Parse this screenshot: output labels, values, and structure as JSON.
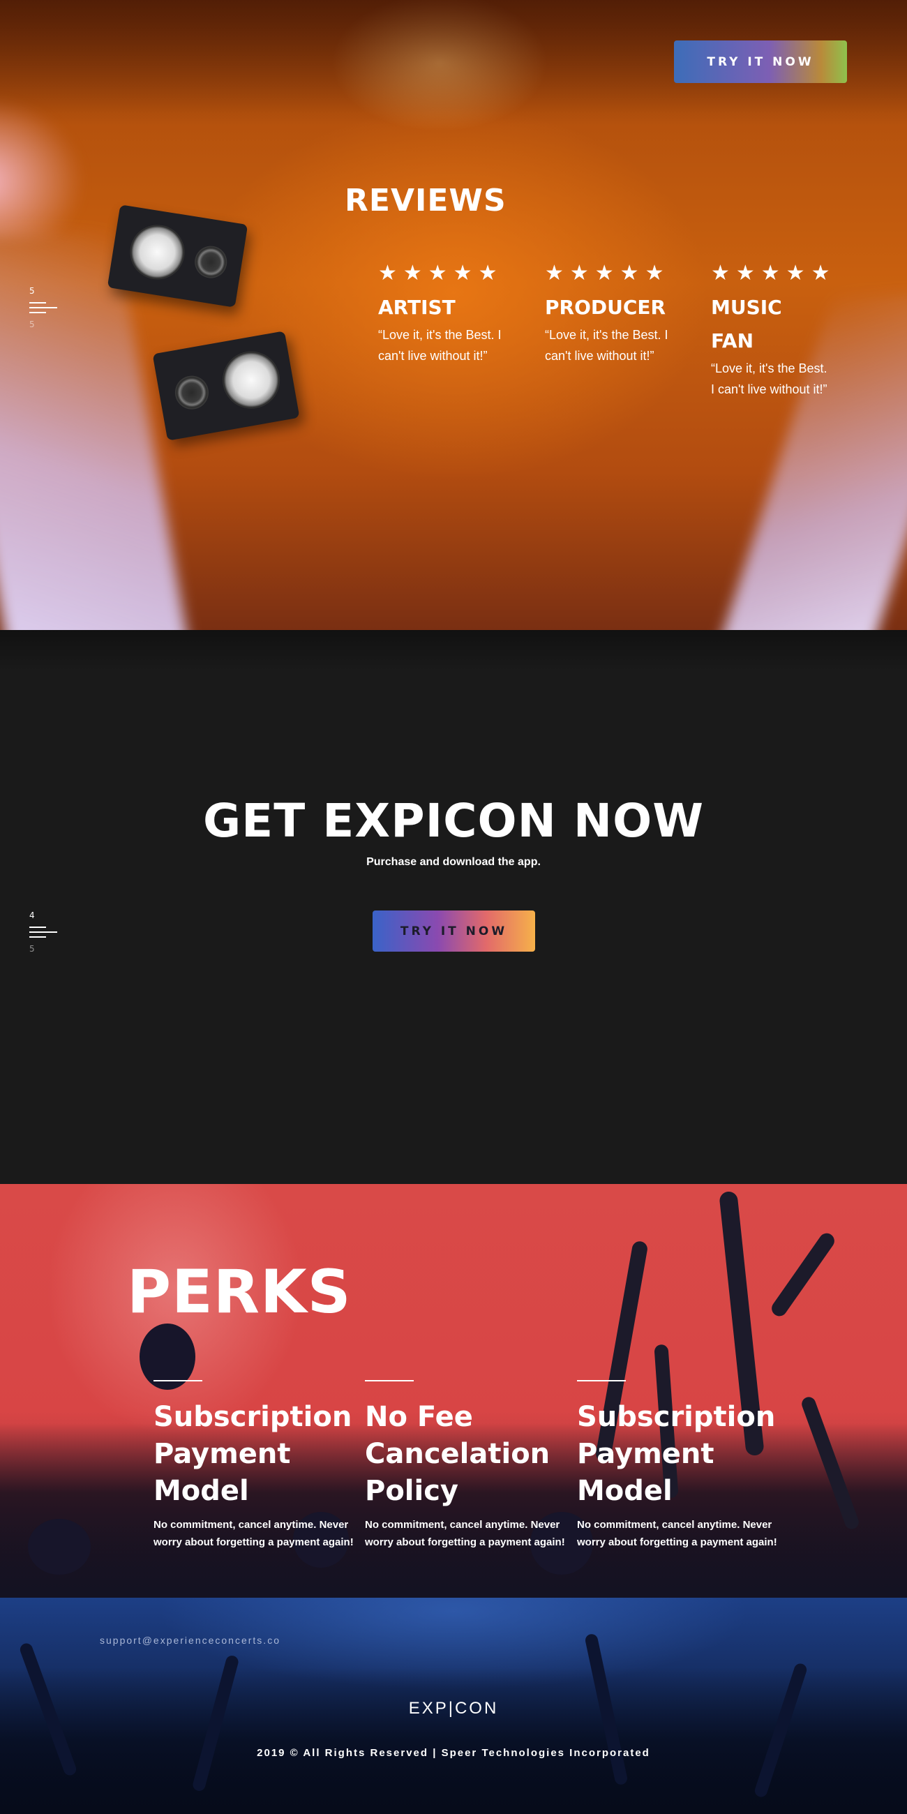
{
  "reviews": {
    "cta_label": "TRY IT NOW",
    "title": "REVIEWS",
    "nav": {
      "current": "5",
      "next": "5"
    },
    "items": [
      {
        "stars": "★★★★★",
        "role": "ARTIST",
        "quote": "“Love it, it's the Best. I can't live without it!”"
      },
      {
        "stars": "★★★★★",
        "role": "PRODUCER",
        "quote": "“Love it, it's the Best. I can't live without it!”"
      },
      {
        "stars": "★★★★★",
        "role": "MUSIC FAN",
        "quote": "“Love it, it's the Best. I can't live without it!”"
      }
    ]
  },
  "get_app": {
    "title": "GET EXPICON NOW",
    "subtitle": "Purchase and download the app.",
    "cta_label": "TRY IT NOW",
    "nav": {
      "current": "4",
      "next": "5"
    }
  },
  "perks": {
    "title": "PERKS",
    "items": [
      {
        "title": "Subscription Payment Model",
        "description": "No commitment, cancel anytime. Never worry about forgetting a payment again!"
      },
      {
        "title": "No Fee Cancelation Policy",
        "description": "No commitment, cancel anytime. Never worry about forgetting a payment again!"
      },
      {
        "title": "Subscription Payment Model",
        "description": "No commitment, cancel anytime. Never worry about forgetting a payment again!"
      }
    ]
  },
  "footer": {
    "support_email": "support@experienceconcerts.co",
    "logo": "EXP|CON",
    "copyright": "2019 © All Rights Reserved | Speer Technologies Incorporated"
  },
  "colors": {
    "reviews_bg": "#c9600f",
    "cta_bg": "#1a1a1a",
    "perks_bg": "#d94a48",
    "footer_bg": "#152c60"
  },
  "icons": {
    "star": "star-icon",
    "menu": "menu-lines-icon"
  }
}
